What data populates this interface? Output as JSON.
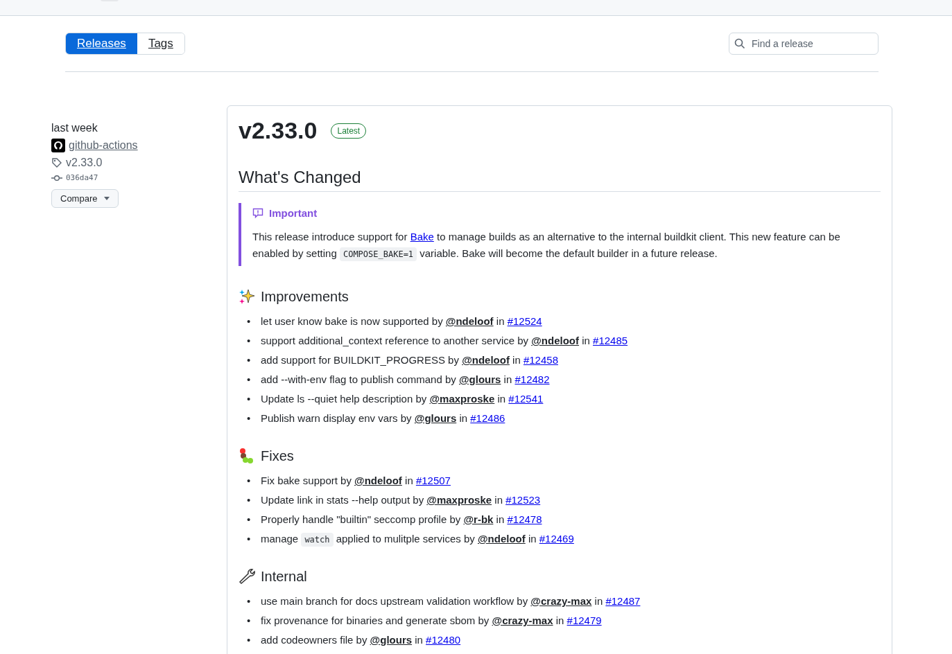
{
  "tabs": [
    {
      "label": "Releases",
      "selected": true
    },
    {
      "label": "Tags",
      "selected": false
    }
  ],
  "search": {
    "placeholder": "Find a release"
  },
  "meta": {
    "date": "last week",
    "author": "github-actions",
    "tag": "v2.33.0",
    "commit": "036da47",
    "compare": "Compare"
  },
  "release": {
    "title": "v2.33.0",
    "badge": "Latest",
    "heading": "What's Changed",
    "note": {
      "title": "Important",
      "segments": [
        {
          "kind": "text",
          "text": "This release introduce support for "
        },
        {
          "kind": "link",
          "text": "Bake"
        },
        {
          "kind": "text",
          "text": " to manage builds as an alternative to the internal buildkit client. This new feature can be enabled by setting "
        },
        {
          "kind": "code",
          "text": "COMPOSE_BAKE=1"
        },
        {
          "kind": "text",
          "text": " variable. Bake will become the default builder in a future release."
        }
      ]
    },
    "sections": [
      {
        "kind": "sparkles",
        "title": "Improvements",
        "marker": "•",
        "items": [
          {
            "segments": [
              {
                "kind": "text",
                "text": "let user know bake is now supported by "
              }
            ],
            "author": "@ndeloof",
            "in": " in ",
            "pr": "#12524"
          },
          {
            "segments": [
              {
                "kind": "text",
                "text": "support additional_context reference to another service by "
              }
            ],
            "author": "@ndeloof",
            "in": " in ",
            "pr": "#12485"
          },
          {
            "segments": [
              {
                "kind": "text",
                "text": "add support for BUILDKIT_PROGRESS by "
              }
            ],
            "author": "@ndeloof",
            "in": " in ",
            "pr": "#12458"
          },
          {
            "segments": [
              {
                "kind": "text",
                "text": "add --with-env flag to publish command by "
              }
            ],
            "author": "@glours",
            "in": " in ",
            "pr": "#12482"
          },
          {
            "segments": [
              {
                "kind": "text",
                "text": "Update ls --quiet help description by "
              }
            ],
            "author": "@maxproske",
            "in": " in ",
            "pr": "#12541"
          },
          {
            "segments": [
              {
                "kind": "text",
                "text": "Publish warn display env vars by "
              }
            ],
            "author": "@glours",
            "in": " in ",
            "pr": "#12486"
          }
        ]
      },
      {
        "kind": "bug",
        "title": "Fixes",
        "marker": "•",
        "items": [
          {
            "segments": [
              {
                "kind": "text",
                "text": "Fix bake support by "
              }
            ],
            "author": "@ndeloof",
            "in": " in ",
            "pr": "#12507"
          },
          {
            "segments": [
              {
                "kind": "text",
                "text": "Update link in stats --help output by "
              }
            ],
            "author": "@maxproske",
            "in": " in ",
            "pr": "#12523"
          },
          {
            "segments": [
              {
                "kind": "text",
                "text": "Properly handle \"builtin\" seccomp profile by "
              }
            ],
            "author": "@r-bk",
            "in": " in ",
            "pr": "#12478"
          },
          {
            "segments": [
              {
                "kind": "text",
                "text": "manage "
              },
              {
                "kind": "code",
                "text": "watch"
              },
              {
                "kind": "text",
                "text": " applied to mulitple services by "
              }
            ],
            "author": "@ndeloof",
            "in": " in ",
            "pr": "#12469"
          }
        ]
      },
      {
        "kind": "wrench",
        "title": "Internal",
        "marker": "•",
        "items": [
          {
            "segments": [
              {
                "kind": "text",
                "text": "use main branch for docs upstream validation workflow by "
              }
            ],
            "author": "@crazy-max",
            "in": " in ",
            "pr": "#12487"
          },
          {
            "segments": [
              {
                "kind": "text",
                "text": "fix provenance for binaries and generate sbom by "
              }
            ],
            "author": "@crazy-max",
            "in": " in ",
            "pr": "#12479"
          },
          {
            "segments": [
              {
                "kind": "text",
                "text": "add codeowners file by "
              }
            ],
            "author": "@glours",
            "in": " in ",
            "pr": "#12480"
          }
        ]
      }
    ]
  }
}
